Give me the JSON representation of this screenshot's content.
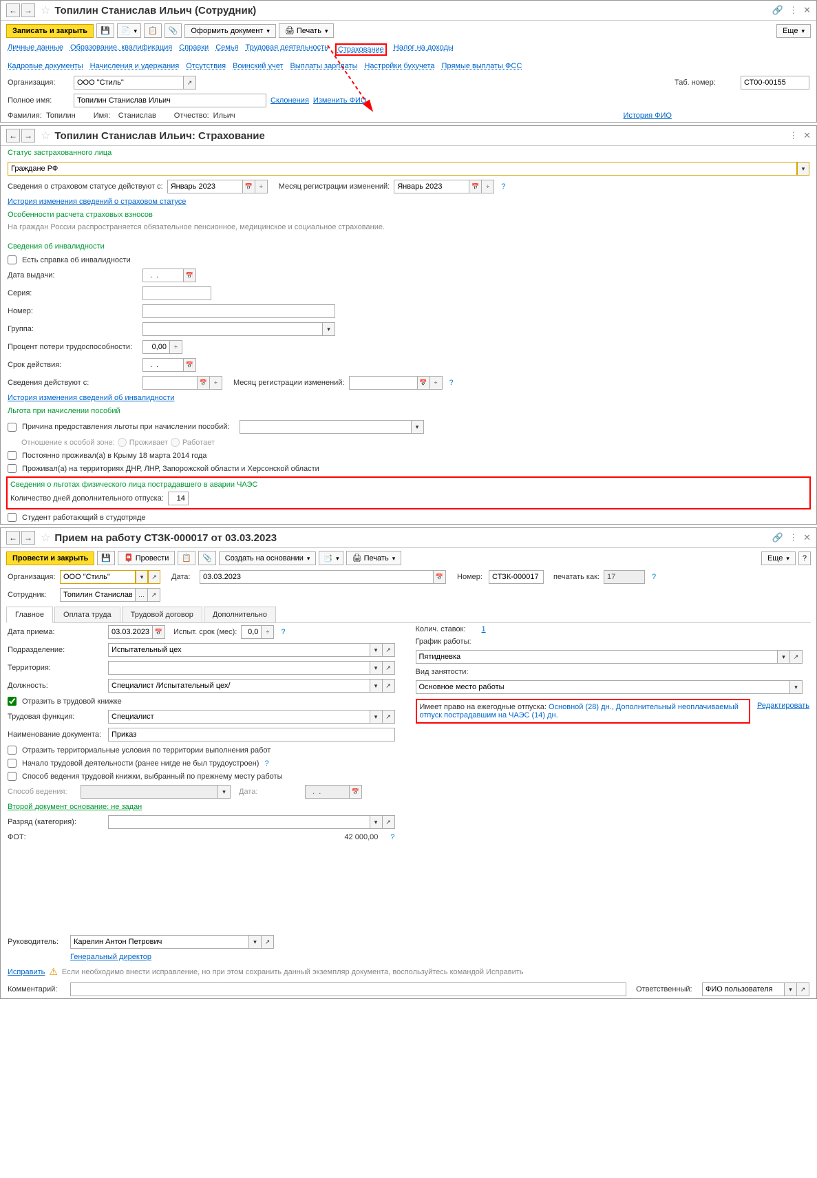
{
  "window1": {
    "title": "Топилин Станислав Ильич (Сотрудник)",
    "saveClose": "Записать и закрыть",
    "createDoc": "Оформить документ",
    "print": "Печать",
    "more": "Еще",
    "tabs": [
      "Личные данные",
      "Образование, квалификация",
      "Справки",
      "Семья",
      "Трудовая деятельность",
      "Страхование",
      "Налог на доходы"
    ],
    "tabs2": [
      "Кадровые документы",
      "Начисления и удержания",
      "Отсутствия",
      "Воинский учет",
      "Выплаты зарплаты",
      "Настройки бухучета",
      "Прямые выплаты ФСС"
    ],
    "orgLabel": "Организация:",
    "orgValue": "ООО \"Стиль\"",
    "tabNoLabel": "Таб. номер:",
    "tabNoValue": "СТ00-00155",
    "fullNameLabel": "Полное имя:",
    "fullNameValue": "Топилин Станислав Ильич",
    "declensions": "Склонения",
    "changeFio": "Изменить ФИО",
    "famLabel": "Фамилия:",
    "famValue": "Топилин",
    "nameLabel": "Имя:",
    "nameValue": "Станислав",
    "patLabel": "Отчество:",
    "patValue": "Ильич",
    "fioHistory": "История ФИО"
  },
  "window2": {
    "title": "Топилин Станислав Ильич: Страхование",
    "statusTitle": "Статус застрахованного лица",
    "statusValue": "Граждане РФ",
    "infoFromLabel": "Сведения о страховом статусе действуют с:",
    "infoFromValue": "Январь 2023",
    "regMonthLabel": "Месяц регистрации изменений:",
    "regMonthValue": "Январь 2023",
    "historyLink": "История изменения сведений о страховом статусе",
    "featuresTitle": "Особенности расчета страховых взносов",
    "featuresNote": "На граждан России распространяется обязательное пенсионное, медицинское и социальное страхование.",
    "disabilityTitle": "Сведения об инвалидности",
    "hasCert": "Есть справка об инвалидности",
    "issueDateLabel": "Дата выдачи:",
    "seriesLabel": "Серия:",
    "numberLabel": "Номер:",
    "groupLabel": "Группа:",
    "percentLabel": "Процент потери трудоспособности:",
    "percentValue": "0,00",
    "validLabel": "Срок действия:",
    "infoFrom2Label": "Сведения действуют с:",
    "regMonth2Label": "Месяц регистрации изменений:",
    "disHistoryLink": "История изменения сведений об инвалидности",
    "benefitTitle": "Льгота при начислении пособий",
    "benefitReason": "Причина предоставления льготы при начислении пособий:",
    "zoneLabel": "Отношение к особой зоне:",
    "zoneLive": "Проживает",
    "zoneWork": "Работает",
    "crimea": "Постоянно проживал(а) в Крыму 18 марта 2014 года",
    "dnr": "Проживал(а) на территориях ДНР, ЛНР, Запорожской области и Херсонской области",
    "chaesTitle": "Сведения о льготах физического лица пострадавшего в аварии ЧАЭС",
    "chaesDaysLabel": "Количество дней дополнительного отпуска:",
    "chaesDaysValue": "14",
    "student": "Студент работающий в студотряде"
  },
  "window3": {
    "title": "Прием на работу СТЗК-000017 от 03.03.2023",
    "postClose": "Провести и закрыть",
    "post": "Провести",
    "createBased": "Создать на основании",
    "print": "Печать",
    "more": "Еще",
    "orgLabel": "Организация:",
    "orgValue": "ООО \"Стиль\"",
    "dateLabel": "Дата:",
    "dateValue": "03.03.2023",
    "numLabel": "Номер:",
    "numValue": "СТЗК-000017",
    "printAsLabel": "печатать как:",
    "printAsValue": "17",
    "empLabel": "Сотрудник:",
    "empValue": "Топилин Станислав Ильи",
    "tabs": [
      "Главное",
      "Оплата труда",
      "Трудовой договор",
      "Дополнительно"
    ],
    "hireDateLabel": "Дата приема:",
    "hireDateValue": "03.03.2023",
    "probationLabel": "Испыт. срок (мес):",
    "probationValue": "0,0",
    "deptLabel": "Подразделение:",
    "deptValue": "Испытательный цех",
    "terrLabel": "Территория:",
    "posLabel": "Должность:",
    "posValue": "Специалист /Испытательный цех/",
    "workbook": "Отразить в трудовой книжке",
    "funcLabel": "Трудовая функция:",
    "funcValue": "Специалист",
    "docNameLabel": "Наименование документа:",
    "docNameValue": "Приказ",
    "terrCond": "Отразить территориальные условия по территории выполнения работ",
    "firstJob": "Начало трудовой деятельности (ранее нигде не был трудоустроен)",
    "workbookMethod": "Способ ведения трудовой книжки, выбранный по прежнему месту работы",
    "methodLabel": "Способ ведения:",
    "dateLabel2": "Дата:",
    "secondDoc": "Второй документ основание: не задан",
    "rankLabel": "Разряд (категория):",
    "fotLabel": "ФОТ:",
    "fotValue": "42 000,00",
    "ratesLabel": "Колич. ставок:",
    "ratesValue": "1",
    "scheduleLabel": "График работы:",
    "scheduleValue": "Пятидневка",
    "employmentLabel": "Вид занятости:",
    "employmentValue": "Основное место работы",
    "vacationText1": "Имеет право на ежегодные отпуска: ",
    "vacationText2": "Основной (28) дн., Дополнительный неоплачиваемый отпуск пострадавшим на ЧАЭС (14) дн.",
    "editLink": "Редактировать",
    "managerLabel": "Руководитель:",
    "managerValue": "Карелин Антон Петрович",
    "managerPos": "Генеральный директор",
    "fixLink": "Исправить",
    "fixNote": "Если необходимо внести исправление, но при этом сохранить данный экземпляр документа, воспользуйтесь командой Исправить",
    "commentLabel": "Комментарий:",
    "responsibleLabel": "Ответственный:",
    "responsibleValue": "ФИО пользователя"
  }
}
